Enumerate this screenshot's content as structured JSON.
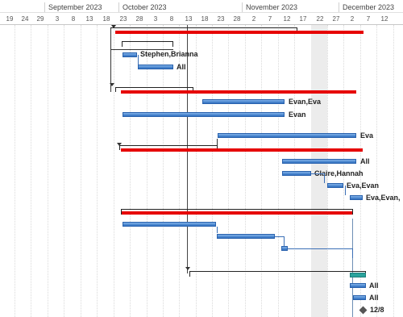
{
  "timescale": {
    "months": [
      "September 2023",
      "October 2023",
      "November 2023",
      "December 2023"
    ],
    "days": [
      "19",
      "24",
      "29",
      "3",
      "8",
      "13",
      "18",
      "23",
      "28",
      "3",
      "8",
      "13",
      "18",
      "23",
      "28",
      "2",
      "7",
      "12",
      "17",
      "22",
      "27",
      "2",
      "7",
      "12"
    ]
  },
  "resources": {
    "r1": "Stephen,Brianna",
    "r2": "All",
    "r3": "Evan,Eva",
    "r4": "Evan",
    "r5": "Eva",
    "r6": "All",
    "r7": "Claire,Hannah",
    "r8": "Eva,Evan",
    "r9": "Eva,Evan,",
    "r10": "All",
    "r11": "All"
  },
  "milestone": {
    "label": "12/8"
  },
  "colors": {
    "critical": "#e60000",
    "task": "#2f6fbf",
    "summary_teal": "#2aa39d",
    "nonworking": "#ececec"
  }
}
